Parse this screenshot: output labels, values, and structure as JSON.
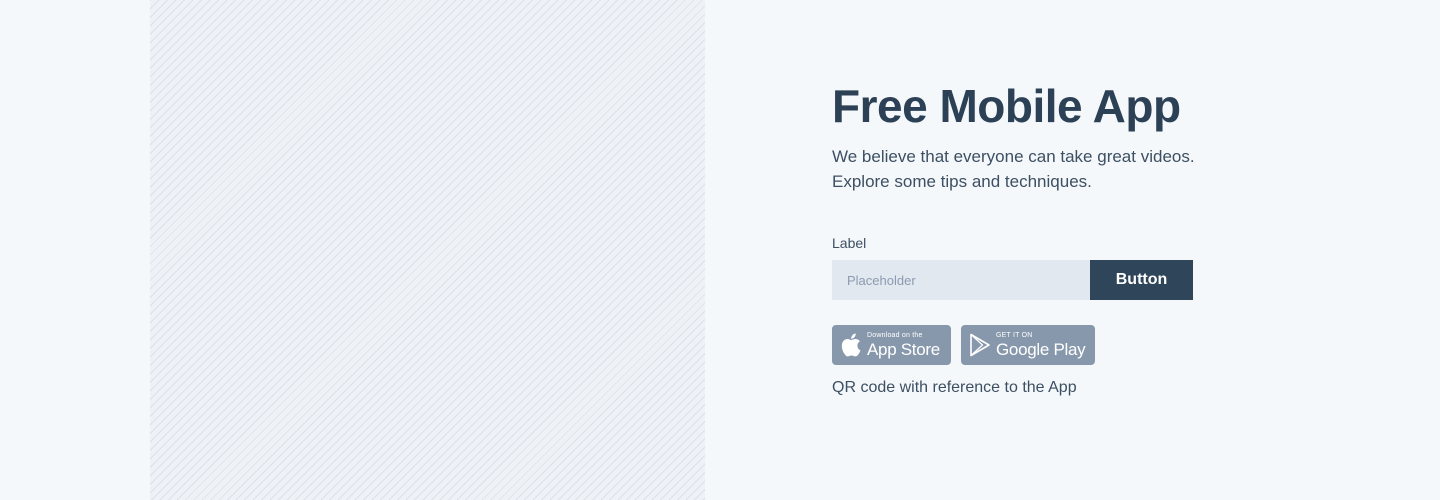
{
  "hero": {
    "title": "Free Mobile App",
    "description": "We believe that everyone can take great videos. Explore some tips and techniques."
  },
  "form": {
    "label": "Label",
    "placeholder": "Placeholder",
    "button_label": "Button"
  },
  "badges": {
    "app_store": {
      "small_text": "Download on the",
      "large_text": "App Store",
      "icon": "apple-icon"
    },
    "google_play": {
      "small_text": "GET IT ON",
      "large_text": "Google Play",
      "icon": "google-play-icon"
    }
  },
  "qr_caption": "QR code with reference to the App",
  "colors": {
    "background": "#f4f8fb",
    "primary_text": "#2d4156",
    "button": "#2f4559",
    "input_bg": "#e1e8f0",
    "badge_bg": "#8898ac"
  }
}
